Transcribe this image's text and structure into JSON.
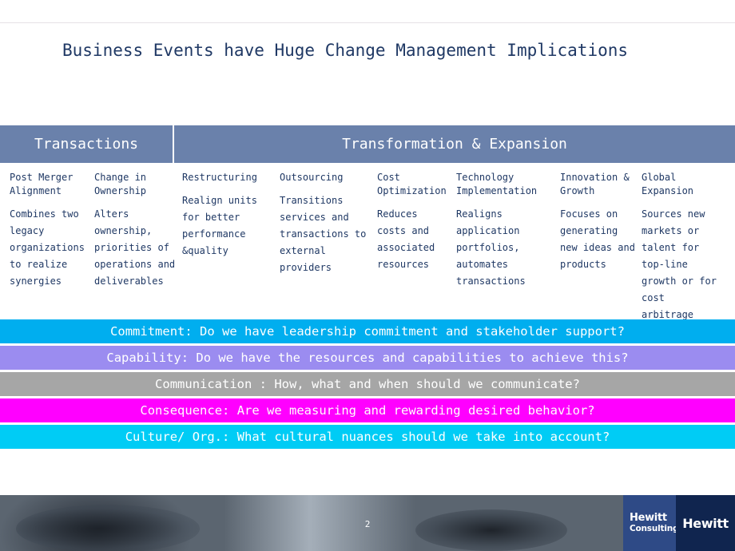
{
  "slide": {
    "title": "Business Events have Huge Change Management Implications",
    "page_number": "2"
  },
  "banner": {
    "left_label": "Transactions",
    "right_label": "Transformation & Expansion",
    "left_color": "#6a81ab",
    "right_color": "#6a81ab",
    "text_color": "#ffffff"
  },
  "columns": [
    {
      "heading": "Post Merger Alignment",
      "body": "Combines two legacy organizations to realize synergies"
    },
    {
      "heading": "Change in Ownership",
      "body": "Alters ownership, priorities of operations and deliverables"
    },
    {
      "heading": "Restructuring",
      "body": "Realign units for better performance &quality"
    },
    {
      "heading": "Outsourcing",
      "body": "Transitions services and transactions to external providers"
    },
    {
      "heading": "Cost Optimization",
      "body": "Reduces costs and associated resources"
    },
    {
      "heading": "Technology Implementation",
      "body": "Realigns application portfolios, automates transactions"
    },
    {
      "heading": "Innovation & Growth",
      "body": "Focuses on generating new ideas and products"
    },
    {
      "heading": "Global Expansion",
      "body": "Sources new markets or talent for top-line growth or for cost arbitrage"
    }
  ],
  "bars": [
    {
      "label": "Commitment: Do we have leadership commitment and stakeholder  support?",
      "color": "#00aeef"
    },
    {
      "label": "Capability: Do we have the resources and capabilities  to achieve this?",
      "color": "#9b8cf0"
    },
    {
      "label": "Communication : How, what and when should we communicate?",
      "color": "#a6a6a6"
    },
    {
      "label": "Consequence: Are we measuring and rewarding desired behavior?",
      "color": "#ff00ff"
    },
    {
      "label": "Culture/ Org.: What cultural nuances should we take into account?",
      "color": "#00ccf5"
    }
  ],
  "logo": {
    "line1": "Hewitt",
    "line2": "Consulting",
    "brand": "Hewitt"
  }
}
